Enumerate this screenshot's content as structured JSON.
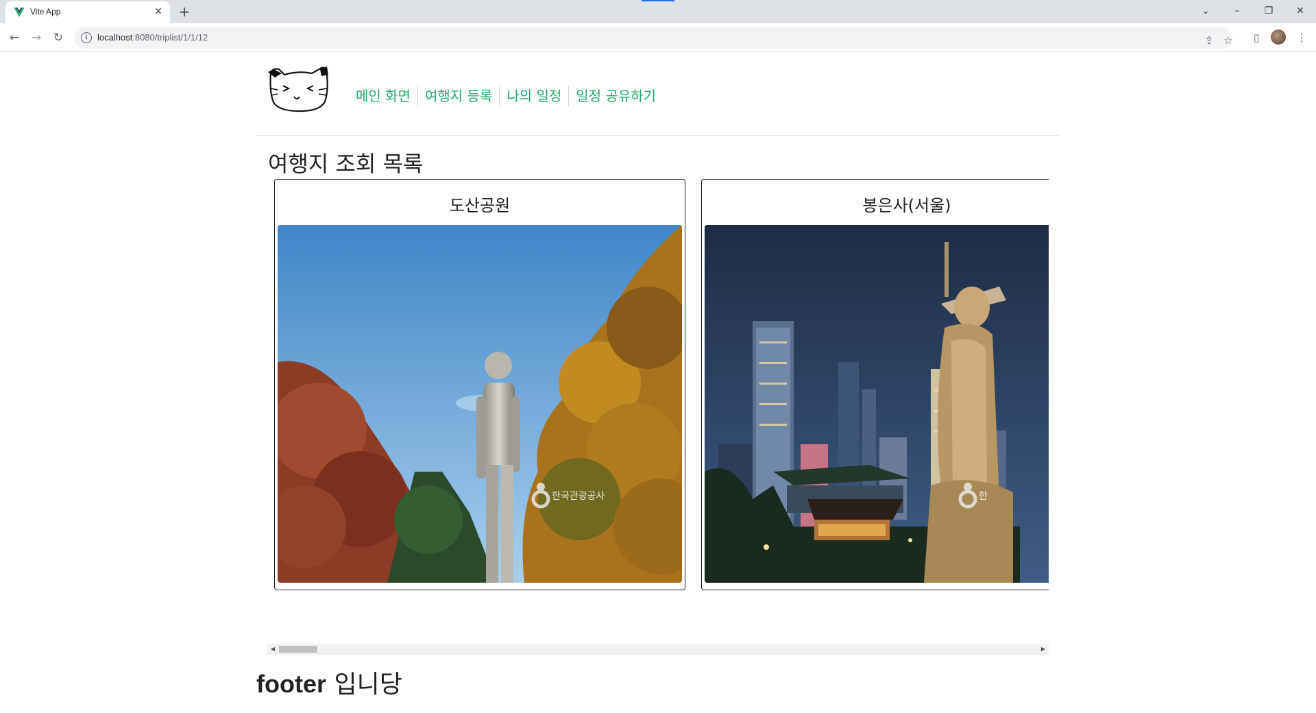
{
  "browser": {
    "tab_title": "Vite App",
    "url_host": "localhost",
    "url_path": ":8080/triplist/1/1/12"
  },
  "header": {
    "nav": [
      "메인 화면",
      "여행지 등록",
      "나의 일정",
      "일정 공유하기"
    ]
  },
  "main": {
    "title": "여행지 조회 목록",
    "cards": [
      {
        "title": "도산공원",
        "watermark": "한국관광공사"
      },
      {
        "title": "봉은사(서울)",
        "watermark": "한"
      }
    ]
  },
  "footer": {
    "text_latin": "footer",
    "text_ko": "입니당"
  },
  "colors": {
    "nav_link": "#1fa86c",
    "tab_strip": "#dee1e6"
  }
}
